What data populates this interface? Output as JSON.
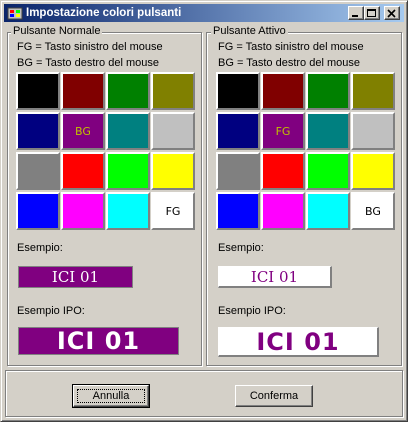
{
  "window": {
    "title": "Impostazione colori pulsanti",
    "icon": "palette-icon",
    "controls": [
      "minimize-icon",
      "maximize-icon",
      "close-icon"
    ]
  },
  "hint_fg": "FG = Tasto sinistro del mouse",
  "hint_bg": "BG = Tasto destro del mouse",
  "palette": [
    "#000000",
    "#800000",
    "#008000",
    "#808000",
    "#000080",
    "#800080",
    "#008080",
    "#c0c0c0",
    "#808080",
    "#ff0000",
    "#00ff00",
    "#ffff00",
    "#0000ff",
    "#ff00ff",
    "#00ffff",
    "#ffffff"
  ],
  "panels": {
    "normal": {
      "title": "Pulsante Normale",
      "fg_marker": "FG",
      "bg_marker": "BG",
      "fg_index": 15,
      "bg_index": 5,
      "example_label": "Esempio:",
      "example_text": "ICI 01",
      "ipo_label": "Esempio IPO:",
      "ipo_text": "ICI 01",
      "fg_color": "#ffffff",
      "bg_color": "#800080"
    },
    "active": {
      "title": "Pulsante Attivo",
      "fg_marker": "FG",
      "bg_marker": "BG",
      "fg_index": 5,
      "bg_index": 15,
      "example_label": "Esempio:",
      "example_text": "ICI 01",
      "ipo_label": "Esempio IPO:",
      "ipo_text": "ICI 01",
      "fg_color": "#800080",
      "bg_color": "#ffffff"
    }
  },
  "buttons": {
    "cancel": "Annulla",
    "confirm": "Conferma"
  }
}
